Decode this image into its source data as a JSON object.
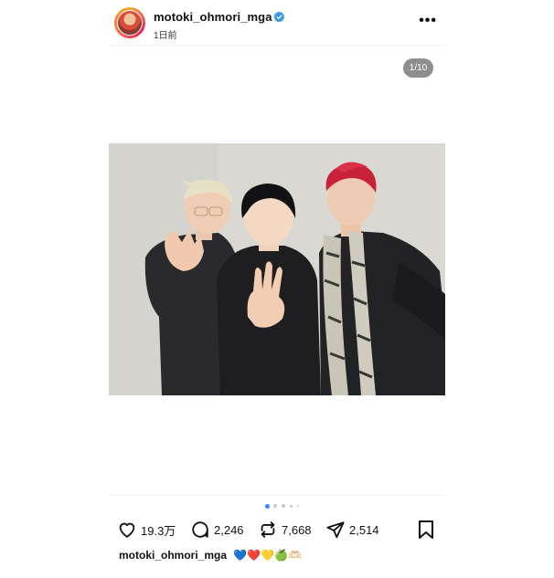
{
  "post": {
    "username": "motoki_ohmori_mga",
    "time_ago": "1日前",
    "more_label": "•••",
    "slide_counter": "1/10",
    "carousel": {
      "count": 5,
      "active": 0
    }
  },
  "actions": {
    "likes": "19.3万",
    "comments": "2,246",
    "reposts": "7,668",
    "shares": "2,514"
  },
  "caption": {
    "username": "motoki_ohmori_mga",
    "emojis": "💙❤️💛🍏🫶🏻"
  },
  "colors": {
    "verified": "#3897f0",
    "dot_active": "#3b82f6",
    "counter_bg": "#8e8e8e"
  }
}
